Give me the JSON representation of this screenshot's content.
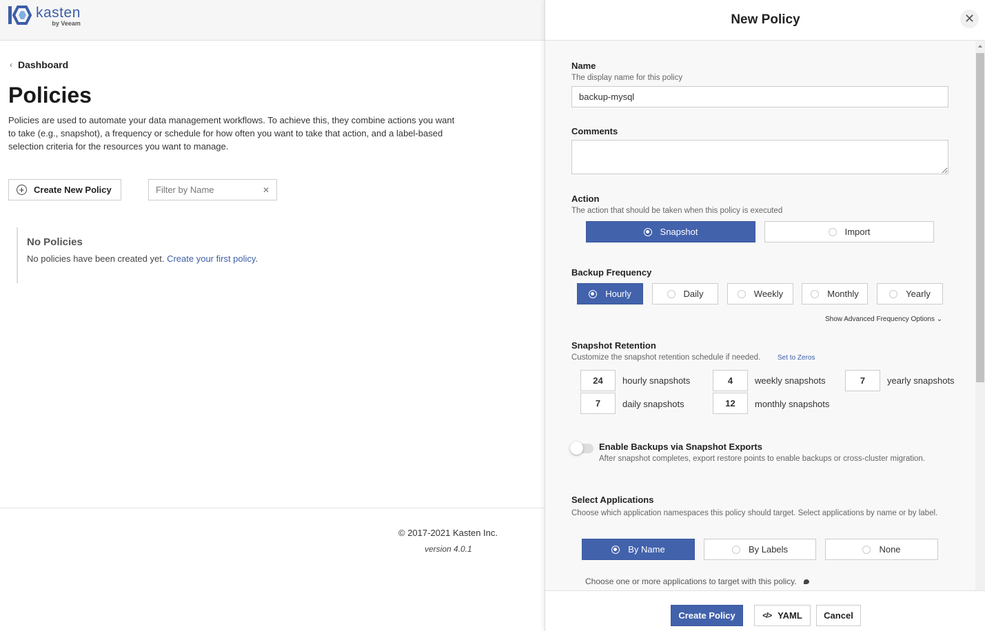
{
  "brand": {
    "name": "kasten",
    "by": "by Veeam",
    "color": "#3d5ea8"
  },
  "left": {
    "breadcrumb": "Dashboard",
    "title": "Policies",
    "description": "Policies are used to automate your data management workflows. To achieve this, they combine actions you want to take (e.g., snapshot), a frequency or schedule for how often you want to take that action, and a label-based selection criteria for the resources you want to manage.",
    "create_button": "Create New Policy",
    "filter_placeholder": "Filter by Name",
    "empty": {
      "heading": "No Policies",
      "text": "No policies have been created yet. ",
      "link": "Create your first policy",
      "suffix": "."
    },
    "footer": {
      "copyright": "© 2017-2021 Kasten Inc.",
      "version": "version 4.0.1"
    }
  },
  "drawer": {
    "title": "New Policy",
    "name": {
      "label": "Name",
      "help": "The display name for this policy",
      "value": "backup-mysql"
    },
    "comments": {
      "label": "Comments",
      "value": ""
    },
    "action": {
      "label": "Action",
      "help": "The action that should be taken when this policy is executed",
      "options": [
        "Snapshot",
        "Import"
      ],
      "selected": "Snapshot"
    },
    "frequency": {
      "label": "Backup Frequency",
      "options": [
        "Hourly",
        "Daily",
        "Weekly",
        "Monthly",
        "Yearly"
      ],
      "selected": "Hourly",
      "advanced_link": "Show Advanced Frequency Options"
    },
    "retention": {
      "label": "Snapshot Retention",
      "help": "Customize the snapshot retention schedule if needed.",
      "zeros_link": "Set to Zeros",
      "hourly": {
        "value": "24",
        "label": "hourly snapshots"
      },
      "daily": {
        "value": "7",
        "label": "daily snapshots"
      },
      "weekly": {
        "value": "4",
        "label": "weekly snapshots"
      },
      "monthly": {
        "value": "12",
        "label": "monthly snapshots"
      },
      "yearly": {
        "value": "7",
        "label": "yearly snapshots"
      }
    },
    "exports": {
      "label": "Enable Backups via Snapshot Exports",
      "help": "After snapshot completes, export restore points to enable backups or cross-cluster migration.",
      "enabled": false
    },
    "applications": {
      "label": "Select Applications",
      "help": "Choose which application namespaces this policy should target. Select applications by name or by label.",
      "options": [
        "By Name",
        "By Labels",
        "None"
      ],
      "selected": "By Name",
      "hint": "Choose one or more applications to target with this policy."
    },
    "footer": {
      "create": "Create Policy",
      "yaml": "YAML",
      "cancel": "Cancel"
    }
  }
}
